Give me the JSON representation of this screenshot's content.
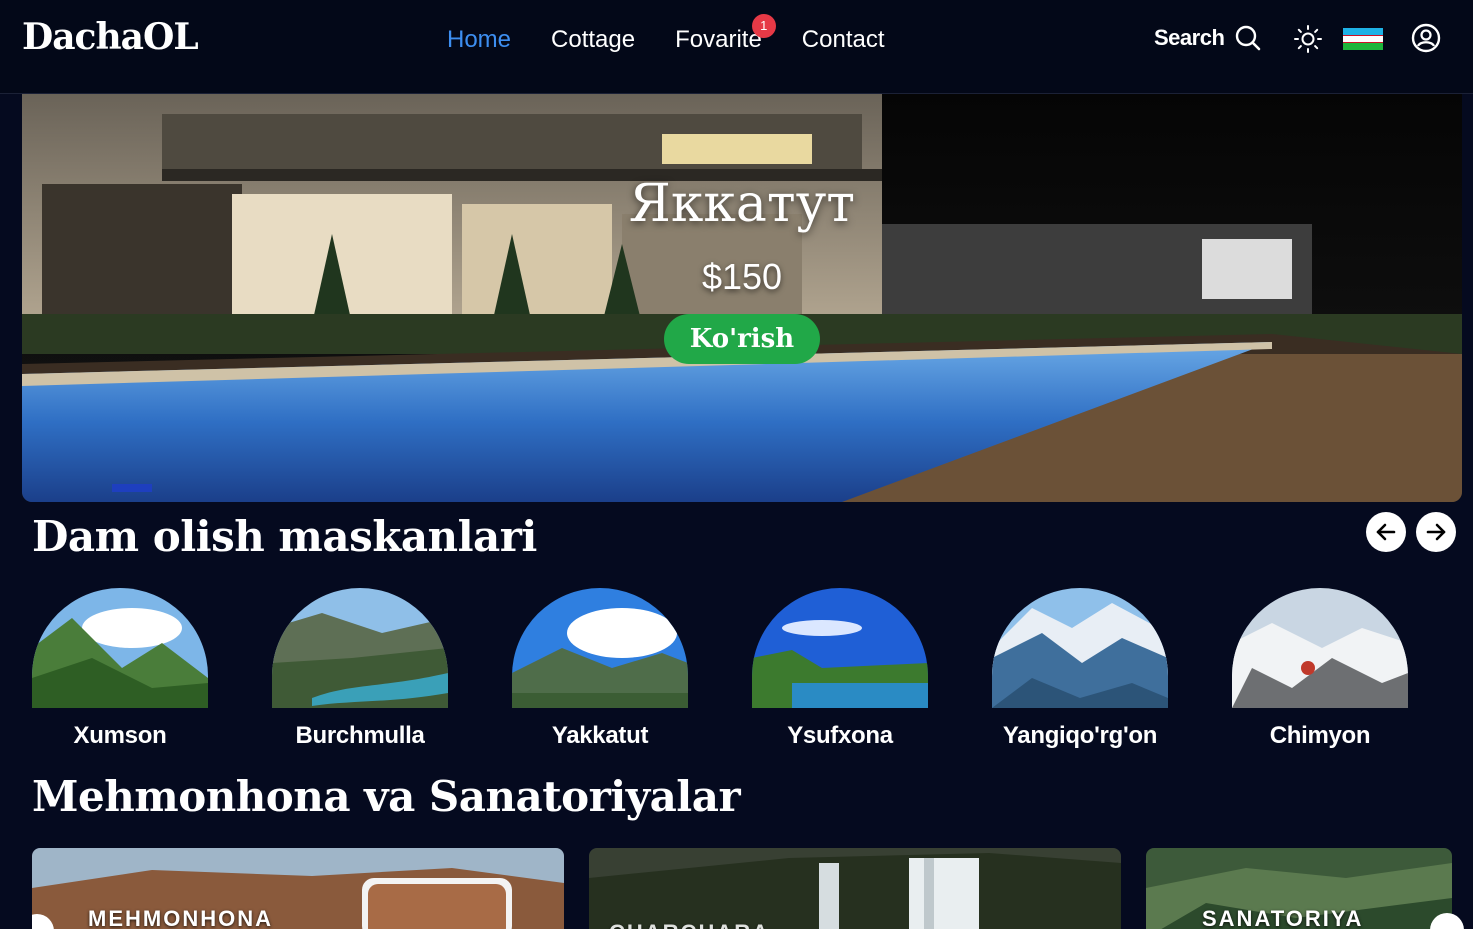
{
  "brand": {
    "logo": "DachaOL"
  },
  "nav": {
    "links": [
      {
        "label": "Home",
        "active": true
      },
      {
        "label": "Cottage"
      },
      {
        "label": "Fovarite",
        "badge": "1"
      },
      {
        "label": "Contact"
      }
    ],
    "search_label": "Search"
  },
  "hero": {
    "title": "Яккатут",
    "price": "$150",
    "cta": "Ko'rish"
  },
  "sections": {
    "resorts_title": "Dam olish maskanlari",
    "hotels_title": "Mehmonhona va Sanatoriyalar"
  },
  "resorts": [
    {
      "name": "Xumson"
    },
    {
      "name": "Burchmulla"
    },
    {
      "name": "Yakkatut"
    },
    {
      "name": "Ysufxona"
    },
    {
      "name": "Yangiqo'rg'on"
    },
    {
      "name": "Chimyon"
    }
  ],
  "hotels": [
    {
      "label": "MEHMONHONA"
    },
    {
      "label": "CHARCHARA"
    },
    {
      "label": "SANATORIYA"
    }
  ],
  "colors": {
    "background": "#050a1f",
    "accent_link": "#3d8ef0",
    "cta_green": "#21a848",
    "badge_red": "#e63946"
  },
  "icons": [
    "search-icon",
    "sun-icon",
    "uzbekistan-flag-icon",
    "user-circle-icon",
    "arrow-left-icon",
    "arrow-right-icon"
  ]
}
